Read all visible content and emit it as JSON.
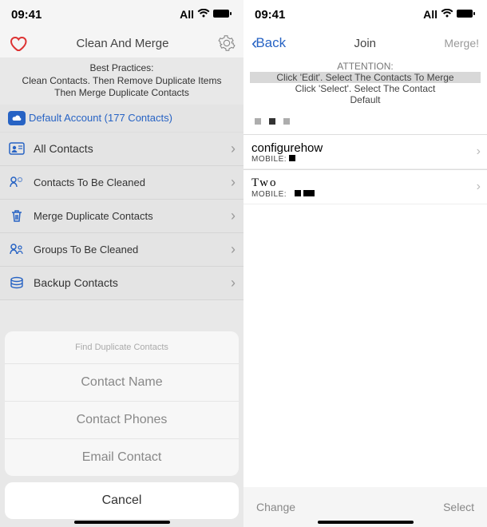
{
  "status": {
    "time": "09:41",
    "carrier": "All"
  },
  "left": {
    "title": "Clean And Merge",
    "instructions": {
      "line1": "Best Practices:",
      "line2": "Clean Contacts. Then Remove Duplicate Items",
      "line3": "Then Merge Duplicate Contacts"
    },
    "account": "Default Account (177 Contacts)",
    "items": [
      {
        "label": "All Contacts"
      },
      {
        "label": "Contacts To Be Cleaned"
      },
      {
        "label": "Merge Duplicate Contacts"
      },
      {
        "label": "Groups To Be Cleaned"
      },
      {
        "label": "Backup Contacts"
      }
    ],
    "sheet": {
      "title": "Find Duplicate Contacts",
      "options": [
        {
          "label": "Contact Name"
        },
        {
          "label": "Contact Phones"
        },
        {
          "label": "Email Contact"
        }
      ],
      "cancel": "Cancel"
    }
  },
  "right": {
    "back": "Back",
    "title": "Join",
    "merge": "Merge!",
    "attention": {
      "title": "ATTENTION:",
      "line1": "Click 'Edit'. Select The Contacts To Merge",
      "line2": "Click 'Select'. Select The Contact",
      "line3": "Default"
    },
    "contacts": [
      {
        "name": "configurehow",
        "sub": "MOBILE:"
      },
      {
        "name": "Two",
        "sub": "MOBILE:"
      }
    ],
    "bottom": {
      "left": "Change",
      "right": "Select"
    }
  }
}
